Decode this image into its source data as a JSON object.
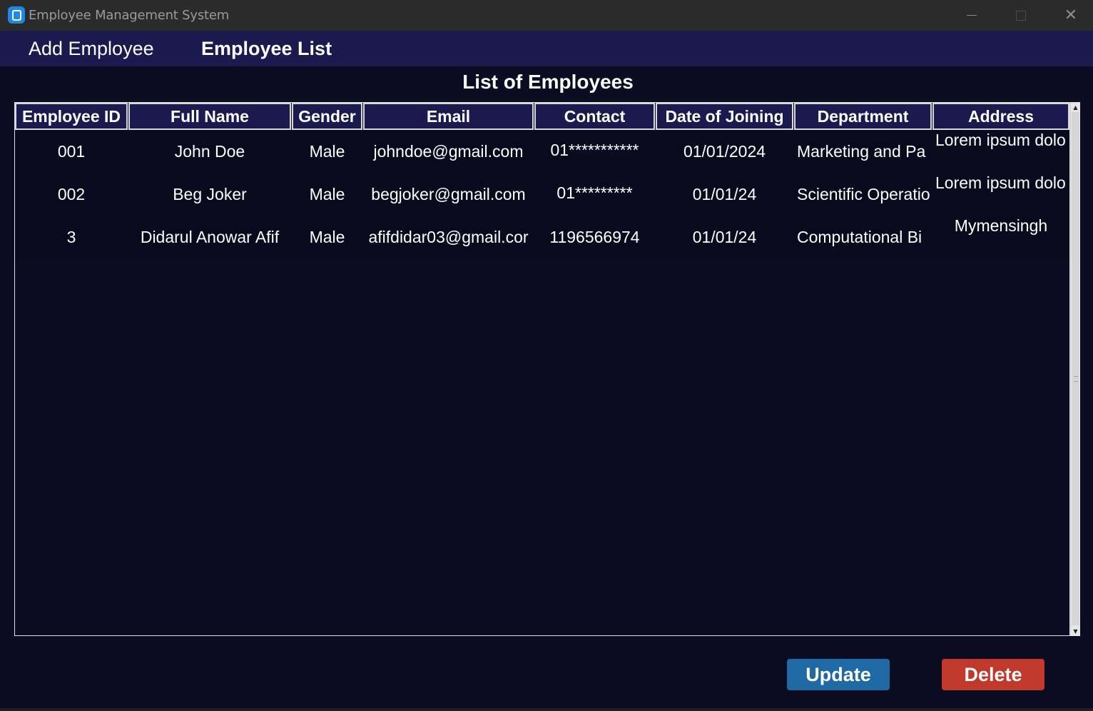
{
  "window": {
    "title": "Employee Management System",
    "close_glyph": "✕"
  },
  "nav": {
    "add_employee": "Add Employee",
    "employee_list": "Employee List",
    "active": "Employee List"
  },
  "main": {
    "heading": "List of Employees"
  },
  "table": {
    "columns": [
      "Employee ID",
      "Full Name",
      "Gender",
      "Email",
      "Contact",
      "Date of Joining",
      "Department",
      "Address"
    ],
    "rows": [
      [
        "001",
        "John Doe",
        "Male",
        "johndoe@gmail.com",
        "01***********",
        "01/01/2024",
        "Marketing and Pa",
        "Lorem ipsum dolo"
      ],
      [
        "002",
        "Beg Joker",
        "Male",
        "begjoker@gmail.com",
        "01*********",
        "01/01/24",
        "Scientific Operatio",
        "Lorem ipsum dolo"
      ],
      [
        "3",
        "Didarul Anowar Afif",
        "Male",
        "afifdidar03@gmail.cor",
        "1196566974",
        "01/01/24",
        "Computational Bi",
        "Mymensingh"
      ]
    ]
  },
  "scrollbar": {
    "up_glyph": "▲",
    "down_glyph": "▼"
  },
  "actions": {
    "update_label": "Update",
    "delete_label": "Delete"
  },
  "colors": {
    "background": "#0b0b21",
    "nav_bar": "#1a1a4f",
    "header_cell": "#1a1a4f",
    "update_button": "#1f6aa5",
    "delete_button": "#c0392b"
  }
}
